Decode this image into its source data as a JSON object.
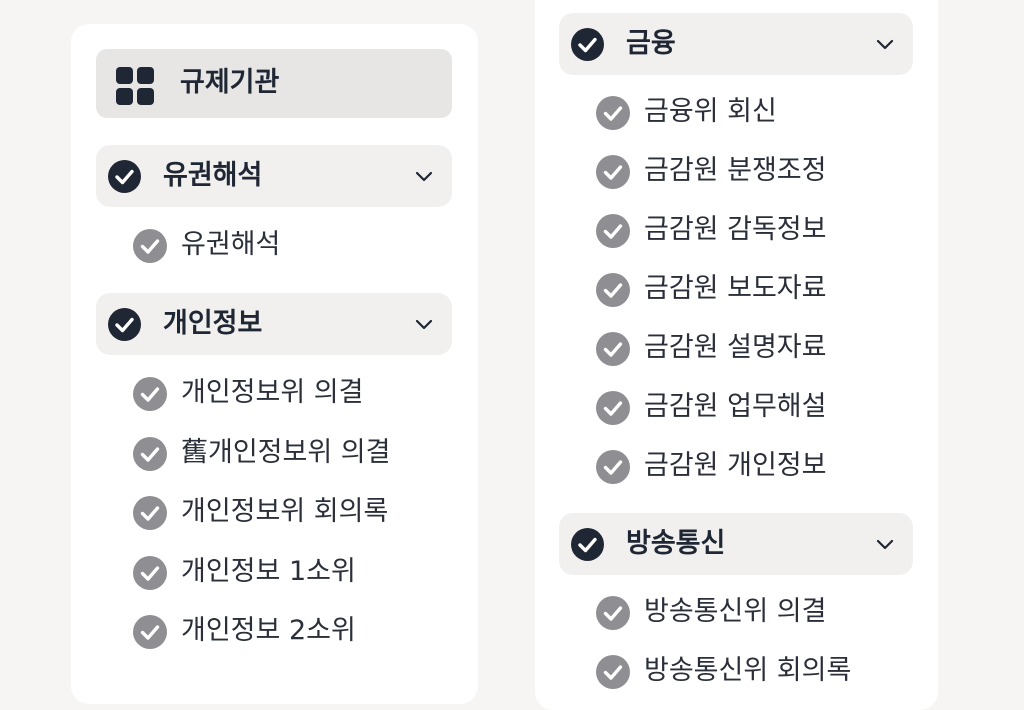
{
  "colors": {
    "dark": "#1f2634",
    "gray_check": "#8e8e93",
    "header_bg": "#f1f0ee",
    "title_bg": "#e7e6e4"
  },
  "left": {
    "title": "규제기관",
    "title_icon": "grid-icon",
    "groups": [
      {
        "label": "유권해석",
        "items": [
          "유권해석"
        ]
      },
      {
        "label": "개인정보",
        "items": [
          "개인정보위 의결",
          "舊개인정보위 의결",
          "개인정보위 회의록",
          "개인정보 1소위",
          "개인정보 2소위"
        ]
      }
    ]
  },
  "right": {
    "groups": [
      {
        "label": "금융",
        "items": [
          "금융위 회신",
          "금감원 분쟁조정",
          "금감원 감독정보",
          "금감원 보도자료",
          "금감원 설명자료",
          "금감원 업무해설",
          "금감원 개인정보"
        ]
      },
      {
        "label": "방송통신",
        "items": [
          "방송통신위 의결",
          "방송통신위 회의록"
        ]
      }
    ]
  }
}
